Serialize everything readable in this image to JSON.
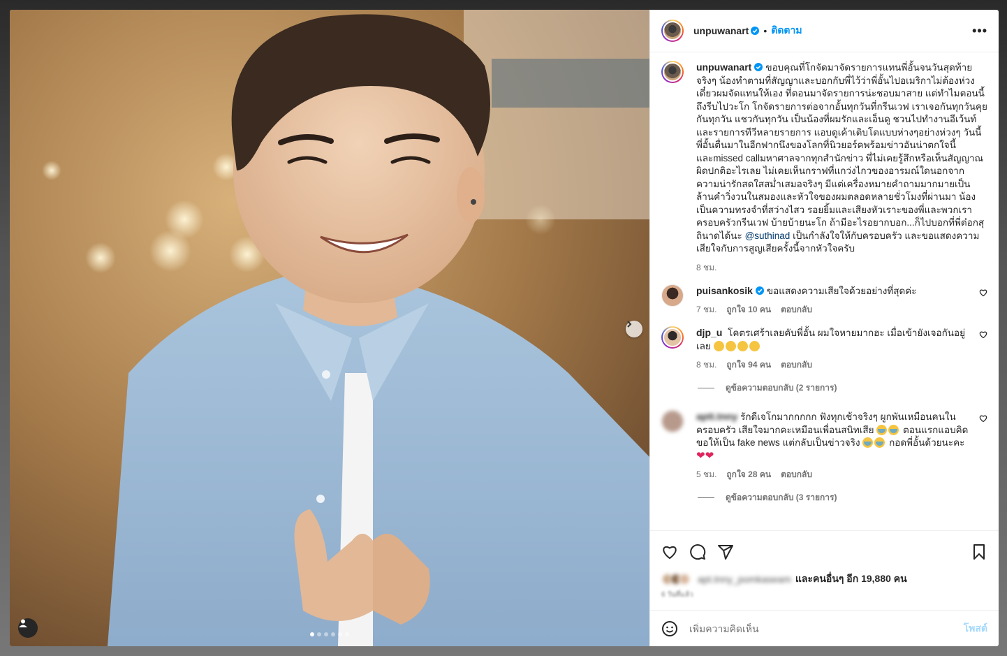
{
  "post": {
    "username": "unpuwanart",
    "follow_label": "ติดตาม",
    "more_label": "•••",
    "separator": "•",
    "caption": "ขอบคุณที่โกจัดมาจัดรายการแทนพี่อั้นจนวันสุดท้ายจริงๆ น้องทำตามที่สัญญาและบอกกับพี่ไว้ว่าพี่อั้นไปอเมริกาไม่ต้องห่วงเดี๋ยวผมจัดแทนให้เอง ที่ตอนมาจัดรายการน่ะชอบมาสาย แต่ทำไมตอนนี้ถึงรีบไปวะโก โกจัดรายการต่อจากอั้นทุกวันที่กรีนเวฟ เราเจอกันทุกวันคุยกันทุกวัน แชวกันทุกวัน เป็นน้องที่ผมรักและเอ็นดู ชวนไปทำงานอีเว้นท์และรายการทีวีหลายรายการ แอบดูเค้าเติบโตแบบห่างๆอย่างห่วงๆ วันนี้พี่อั้นตื่นมาในอีกฟากนึงของโลกที่นิวยอร์คพร้อมข่าวอันน่าตกใจนี้และmissed callมหาศาลจากทุกสำนักข่าว พี่ไม่เคยรู้สึกหรือเห็นสัญญาณผิดปกติอะไรเลย ไม่เคยเห็นกราฟที่แกว่งไกวของอารมณ์ใดนอกจากความน่ารักสดใสสม่ำเสมอจริงๆ มีแต่เครื่องหมายคำถามมากมายเป็นล้านคำวิ่งวนในสมองและหัวใจของผมตลอดหลายชั่วโมงที่ผ่านมา น้องเป็นความทรงจำที่สว่างไสว รอยยิ้มและเสียงหัวเราะของพี่และพวกเราครอบครัวกรีนเวฟ บ้ายบ้ายนะโก ถ้ามีอะไรอยากบอก...ก็ไปบอกที่พี่ต๋อกสุถินาดได้นะ",
    "mention": "@suthinad",
    "caption_tail": "เป็นกำลังใจให้กับครอบครัว และขอแสดงความเสียใจกับการสูญเสียครั้งนี้จากหัวใจครับ",
    "time": "8 ชม."
  },
  "comments": [
    {
      "username": "puisankosik",
      "text": "ขอแสดงความเสียใจด้วยอย่างที่สุดค่ะ",
      "time": "7 ชม.",
      "likes": "ถูกใจ 10 คน",
      "reply": "ตอบกลับ"
    },
    {
      "username": "djp_u",
      "text": "โคตรเศร้าเลยคับพี่อั้น ผมใจหายมากฮะ เมื่อเข้ายังเจอกันอยู่เลย",
      "time": "8 ชม.",
      "likes": "ถูกใจ 94 คน",
      "reply": "ตอบกลับ",
      "view_replies": "ดูข้อความตอบกลับ (2 รายการ)"
    },
    {
      "username": "aptt.tnny",
      "text_a": "รักดีเจโกมากกกกก ฟังทุกเช้าจริงๆ ผูกพันเหมือนคนในครอบครัว เสียใจมากคะเหมือนเพื่อนสนิทเสีย",
      "text_b": "ตอนแรกแอบคิดขอให้เป็น fake news แต่กลับเป็นข่าวจริง",
      "text_c": "กอดพี่อั้นด้วยนะคะ",
      "time": "5 ชม.",
      "likes": "ถูกใจ 28 คน",
      "reply": "ตอบกลับ",
      "view_replies": "ดูข้อความตอบกลับ (3 รายการ)"
    }
  ],
  "likes_bar": {
    "liked_by_blurred": "apt.tnny_pomkaseam",
    "others": "และคนอื่นๆ อีก 19,880 คน",
    "ago": "6 วันที่แล้ว"
  },
  "composer": {
    "placeholder": "เพิ่มความคิดเห็น",
    "post_label": "โพสต์"
  },
  "icons": {
    "like": "heart-icon",
    "comment": "comment-icon",
    "share": "share-icon",
    "save": "bookmark-icon",
    "emoji": "emoji-icon"
  },
  "colors": {
    "accent": "#0095f6",
    "verified": "#0095f6",
    "text": "#262626",
    "muted": "#737373"
  },
  "carousel": {
    "total": 6,
    "active_index": 0
  }
}
